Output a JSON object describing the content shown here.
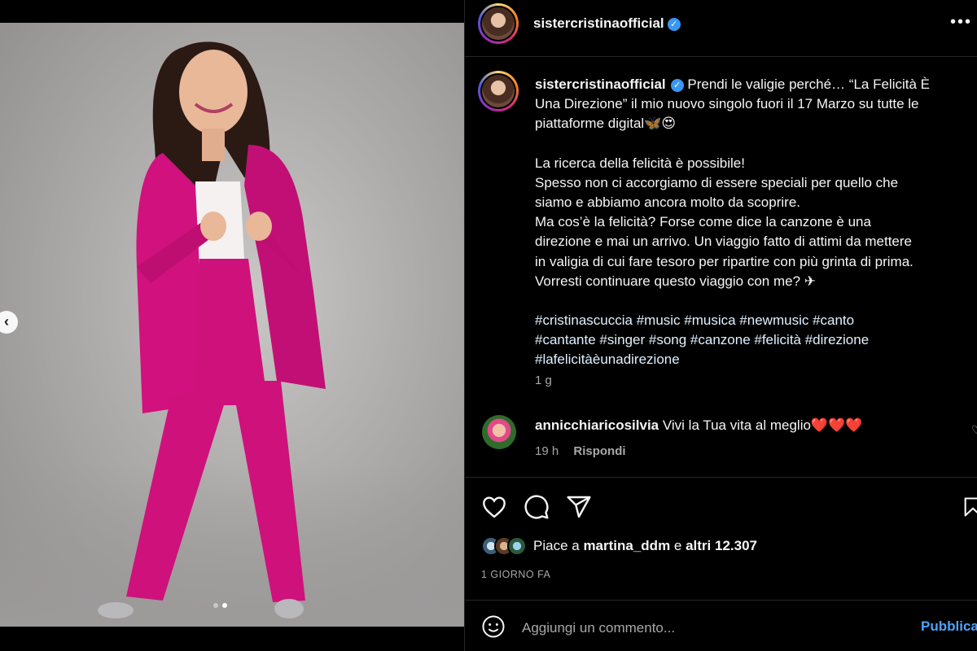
{
  "post": {
    "username": "sistercristinaofficial",
    "verified": true
  },
  "caption": {
    "username": "sistercristinaofficial",
    "lines_p1": [
      "Prendi le valigie perché… “La Felicità È",
      "Una Direzione” il mio nuovo singolo fuori il 17 Marzo su tutte le",
      "piattaforme digital🦋😍"
    ],
    "lines_p2": [
      "La ricerca della felicità è possibile!",
      "Spesso non ci accorgiamo di essere speciali per quello che",
      "siamo e abbiamo ancora molto da scoprire.",
      "Ma cos’è la felicità? Forse come dice la canzone è una",
      "direzione e mai un arrivo. Un viaggio fatto di attimi da mettere",
      "in valigia di cui fare tesoro per ripartire con più grinta di prima.",
      "Vorresti continuare questo viaggio con me? ✈"
    ],
    "hashtags": [
      "#cristinascuccia #music #musica #newmusic #canto",
      "#cantante #singer #song #canzone #felicità #direzione",
      "#lafelicitàèunadirezione"
    ],
    "time_ago": "1 g"
  },
  "comment": {
    "username": "annicchiaricosilvia",
    "text": "Vivi la Tua vita al meglio❤️❤️❤️",
    "time": "19 h",
    "reply_label": "Rispondi"
  },
  "likes": {
    "prefix": "Piace a ",
    "user": "martina_ddm",
    "middle": " e ",
    "others": "altri 12.307"
  },
  "date_label": "1 GIORNO FA",
  "comment_input": {
    "placeholder": "Aggiungi un commento...",
    "publish_label": "Pubblica"
  },
  "carousel": {
    "current": 2,
    "total": 2
  },
  "icons": {
    "prev": "chevron-left-icon",
    "more": "more-options-icon",
    "like": "heart-icon",
    "comment": "comment-icon",
    "share": "share-icon",
    "save": "bookmark-icon",
    "emoji": "emoji-icon"
  },
  "colors": {
    "background": "#000000",
    "secondary_text": "#a8a8a8",
    "link_blue": "#4ea3f7",
    "verified_blue": "#3897f0",
    "suit_pink": "#d1117e"
  }
}
